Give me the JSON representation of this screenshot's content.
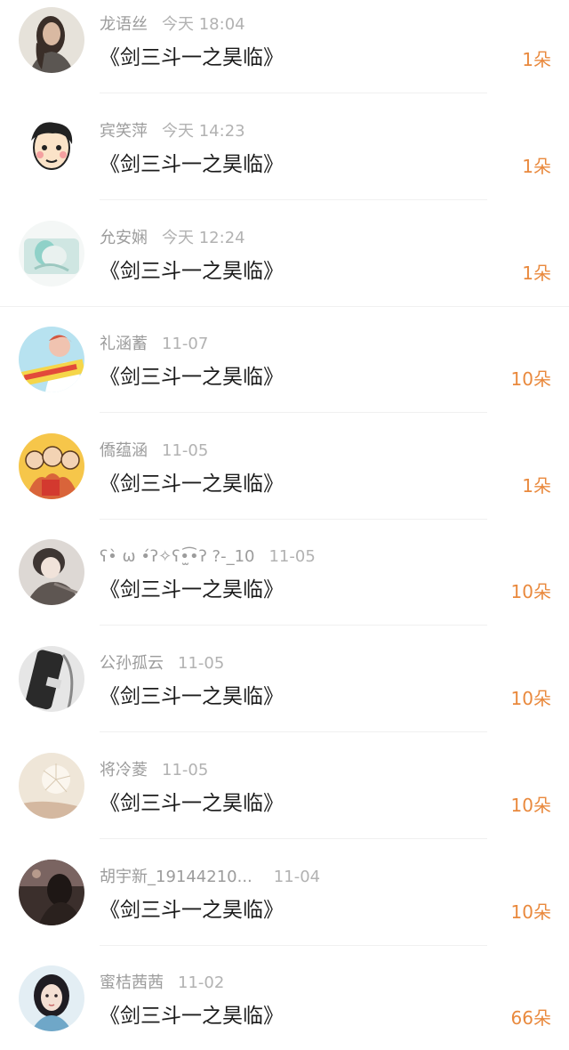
{
  "items": [
    {
      "name": "龙语丝",
      "time": "今天 18:04",
      "title": "《剑三斗一之昊临》",
      "amount": "1朵",
      "avatar": "portrait-woman-dark-hair"
    },
    {
      "name": "宾笑萍",
      "time": "今天 14:23",
      "title": "《剑三斗一之昊临》",
      "amount": "1朵",
      "avatar": "cartoon-boy-face"
    },
    {
      "name": "允安娴",
      "time": "今天 12:24",
      "title": "《剑三斗一之昊临》",
      "amount": "1朵",
      "avatar": "anime-girl-teal"
    },
    {
      "name": "礼涵蓄",
      "time": "11-07",
      "title": "《剑三斗一之昊临》",
      "amount": "10朵",
      "avatar": "girl-with-banner"
    },
    {
      "name": "僑蕴涵",
      "time": "11-05",
      "title": "《剑三斗一之昊临》",
      "amount": "1朵",
      "avatar": "family-cartoon-yellow"
    },
    {
      "name": "ʕ•̀ ω •́ʔ✧ʕ•̫͡•ʔ ?-_10",
      "time": "11-05",
      "title": "《剑三斗一之昊临》",
      "amount": "10朵",
      "avatar": "anime-boy"
    },
    {
      "name": "公孙孤云",
      "time": "11-05",
      "title": "《剑三斗一之昊临》",
      "amount": "10朵",
      "avatar": "phone-dark"
    },
    {
      "name": "将冷菱",
      "time": "11-05",
      "title": "《剑三斗一之昊临》",
      "amount": "10朵",
      "avatar": "dandelion"
    },
    {
      "name": "胡宇新_19144210...",
      "time": "11-04",
      "title": "《剑三斗一之昊临》",
      "amount": "10朵",
      "avatar": "girl-sunset"
    },
    {
      "name": "蜜桔茜茜",
      "time": "11-02",
      "title": "《剑三斗一之昊临》",
      "amount": "66朵",
      "avatar": "woman-portrait"
    }
  ]
}
